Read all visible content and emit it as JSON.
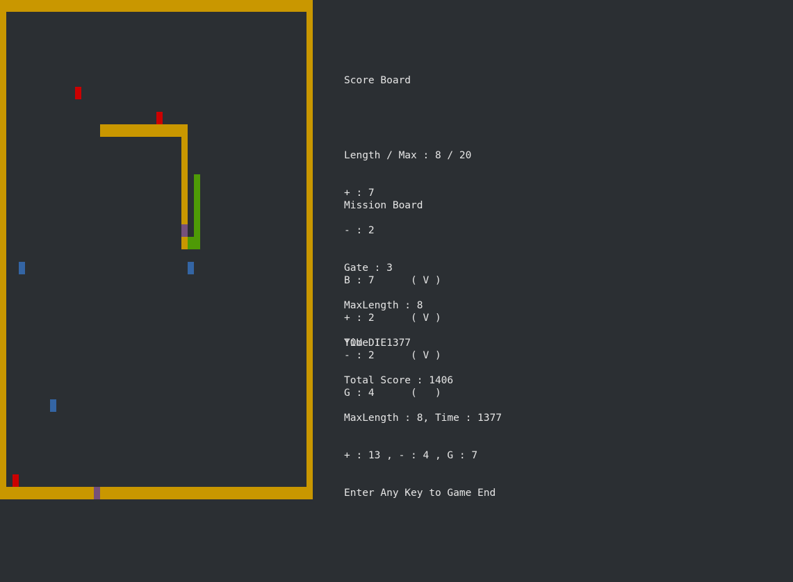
{
  "colors": {
    "background": "#2b2f33",
    "wall": "#c99700",
    "snake_head": "#c99700",
    "snake_body": "#4e9a06",
    "growth_item": "#cc0000",
    "poison_item": "#3465a4",
    "gate": "#75507b",
    "text": "#e6e6e6"
  },
  "score_board": {
    "title": "Score Board",
    "length_max": "Length / Max : 8 / 20",
    "plus": "+ : 7",
    "minus": "- : 2",
    "gate": "Gate : 3",
    "max_length": "MaxLength : 8",
    "time": "Time : 1377"
  },
  "mission_board": {
    "title": "Mission Board",
    "items": [
      "B : 7      ( V )",
      "+ : 2      ( V )",
      "- : 2      ( V )",
      "G : 4      (   )"
    ]
  },
  "game_over": {
    "title": "YOU DIE",
    "total_score": "Total Score : 1406",
    "summary": "MaxLength : 8, Time : 1377",
    "counts": "+ : 13 , - : 4 , G : 7",
    "prompt": "Enter Any Key to Game End"
  }
}
